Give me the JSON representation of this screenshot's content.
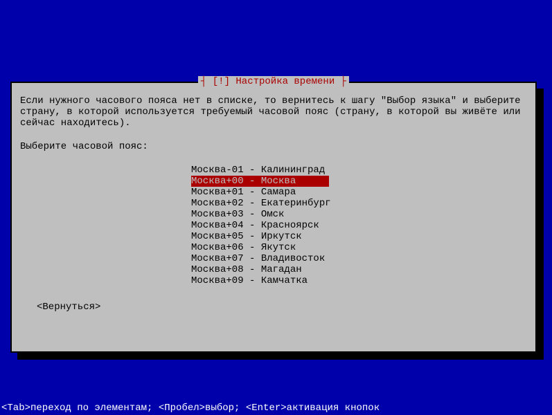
{
  "dialog": {
    "title_marker_left": "┤ ",
    "title_marker_prefix": "[!] ",
    "title_text": "Настройка времени",
    "title_marker_right": " ├",
    "description": "Если нужного часового пояса нет в списке, то вернитесь к шагу \"Выбор языка\" и выберите\nстрану, в которой используется требуемый часовой пояс (страну, в которой вы живёте или\nсейчас находитесь).",
    "prompt": "Выберите часовой пояс:",
    "timezones": [
      {
        "label": "Москва-01 - Калининград",
        "selected": false
      },
      {
        "label": "Москва+00 - Москва",
        "selected": true
      },
      {
        "label": "Москва+01 - Самара",
        "selected": false
      },
      {
        "label": "Москва+02 - Екатеринбург",
        "selected": false
      },
      {
        "label": "Москва+03 - Омск",
        "selected": false
      },
      {
        "label": "Москва+04 - Красноярск",
        "selected": false
      },
      {
        "label": "Москва+05 - Иркутск",
        "selected": false
      },
      {
        "label": "Москва+06 - Якутск",
        "selected": false
      },
      {
        "label": "Москва+07 - Владивосток",
        "selected": false
      },
      {
        "label": "Москва+08 - Магадан",
        "selected": false
      },
      {
        "label": "Москва+09 - Камчатка",
        "selected": false
      }
    ],
    "back_button": "<Вернуться>"
  },
  "status_bar": "<Tab>переход по элементам; <Пробел>выбор; <Enter>активация кнопок"
}
